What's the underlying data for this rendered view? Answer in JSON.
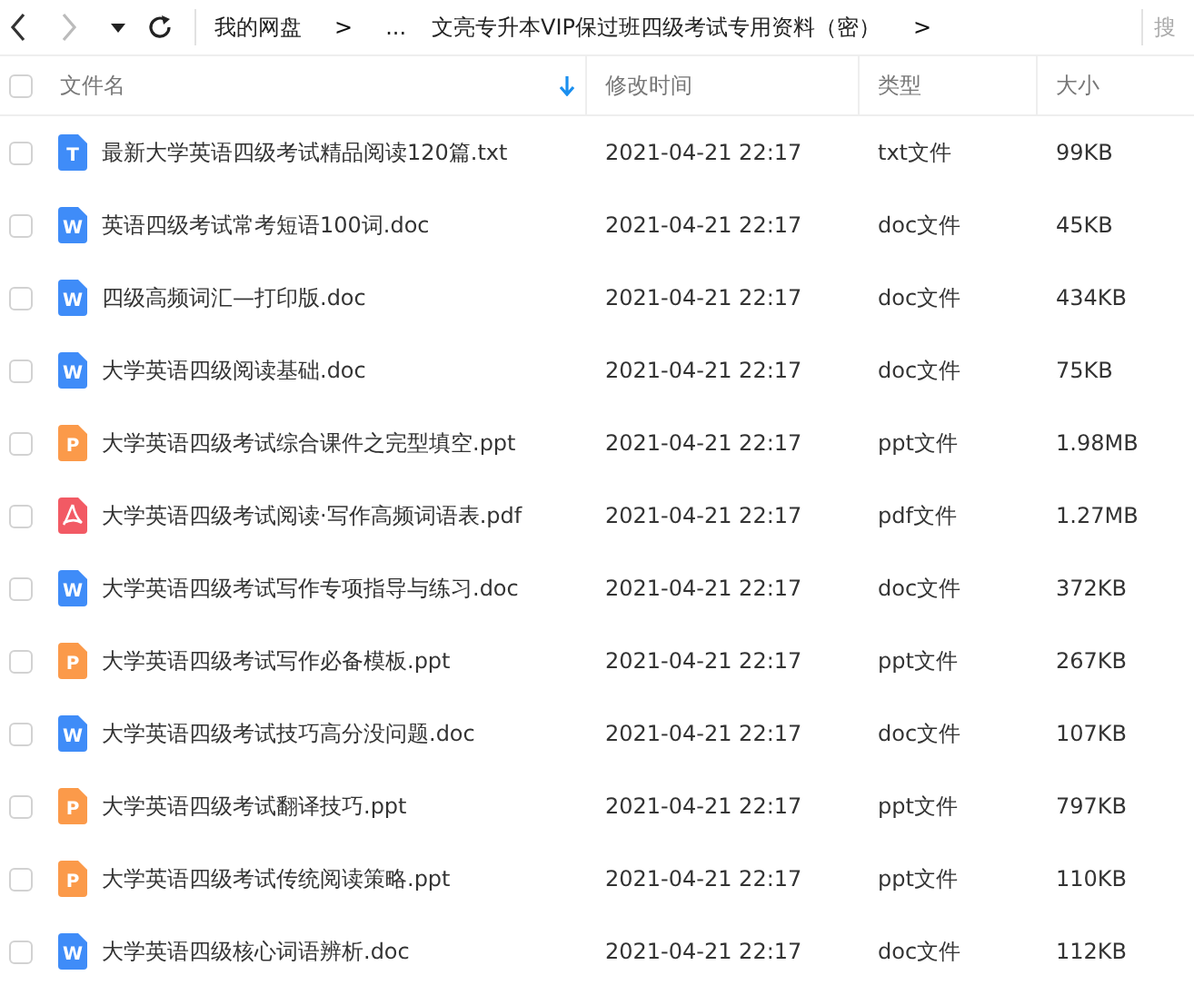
{
  "toolbar": {
    "back_enabled": true,
    "forward_enabled": false,
    "breadcrumb": [
      {
        "label": "我的网盘",
        "kind": "link"
      },
      {
        "label": ">",
        "kind": "sep"
      },
      {
        "label": "...",
        "kind": "link"
      },
      {
        "label": "文亮专升本VIP保过班四级考试专用资料（密）",
        "kind": "link"
      },
      {
        "label": ">",
        "kind": "sep"
      }
    ],
    "search": {
      "placeholder": "搜"
    }
  },
  "table": {
    "all_checked": false,
    "columns": [
      {
        "label": "文件名",
        "sorted": true
      },
      {
        "label": "修改时间",
        "sorted": false
      },
      {
        "label": "类型",
        "sorted": false
      },
      {
        "label": "大小",
        "sorted": false
      }
    ],
    "rows": [
      {
        "checked": false,
        "kind": "txt",
        "icon_letter": "T",
        "name": "最新大学英语四级考试精品阅读120篇.txt",
        "modified": "2021-04-21 22:17",
        "type": "txt文件",
        "size": "99KB"
      },
      {
        "checked": false,
        "kind": "doc",
        "icon_letter": "W",
        "name": "英语四级考试常考短语100词.doc",
        "modified": "2021-04-21 22:17",
        "type": "doc文件",
        "size": "45KB"
      },
      {
        "checked": false,
        "kind": "doc",
        "icon_letter": "W",
        "name": "四级高频词汇—打印版.doc",
        "modified": "2021-04-21 22:17",
        "type": "doc文件",
        "size": "434KB"
      },
      {
        "checked": false,
        "kind": "doc",
        "icon_letter": "W",
        "name": "大学英语四级阅读基础.doc",
        "modified": "2021-04-21 22:17",
        "type": "doc文件",
        "size": "75KB"
      },
      {
        "checked": false,
        "kind": "ppt",
        "icon_letter": "P",
        "name": "大学英语四级考试综合课件之完型填空.ppt",
        "modified": "2021-04-21 22:17",
        "type": "ppt文件",
        "size": "1.98MB"
      },
      {
        "checked": false,
        "kind": "pdf",
        "name": "大学英语四级考试阅读·写作高频词语表.pdf",
        "modified": "2021-04-21 22:17",
        "type": "pdf文件",
        "size": "1.27MB"
      },
      {
        "checked": false,
        "kind": "doc",
        "icon_letter": "W",
        "name": "大学英语四级考试写作专项指导与练习.doc",
        "modified": "2021-04-21 22:17",
        "type": "doc文件",
        "size": "372KB"
      },
      {
        "checked": false,
        "kind": "ppt",
        "icon_letter": "P",
        "name": "大学英语四级考试写作必备模板.ppt",
        "modified": "2021-04-21 22:17",
        "type": "ppt文件",
        "size": "267KB"
      },
      {
        "checked": false,
        "kind": "doc",
        "icon_letter": "W",
        "name": "大学英语四级考试技巧高分没问题.doc",
        "modified": "2021-04-21 22:17",
        "type": "doc文件",
        "size": "107KB"
      },
      {
        "checked": false,
        "kind": "ppt",
        "icon_letter": "P",
        "name": "大学英语四级考试翻译技巧.ppt",
        "modified": "2021-04-21 22:17",
        "type": "ppt文件",
        "size": "797KB"
      },
      {
        "checked": false,
        "kind": "ppt",
        "icon_letter": "P",
        "name": "大学英语四级考试传统阅读策略.ppt",
        "modified": "2021-04-21 22:17",
        "type": "ppt文件",
        "size": "110KB"
      },
      {
        "checked": false,
        "kind": "doc",
        "icon_letter": "W",
        "name": "大学英语四级核心词语辨析.doc",
        "modified": "2021-04-21 22:17",
        "type": "doc文件",
        "size": "112KB"
      }
    ]
  }
}
